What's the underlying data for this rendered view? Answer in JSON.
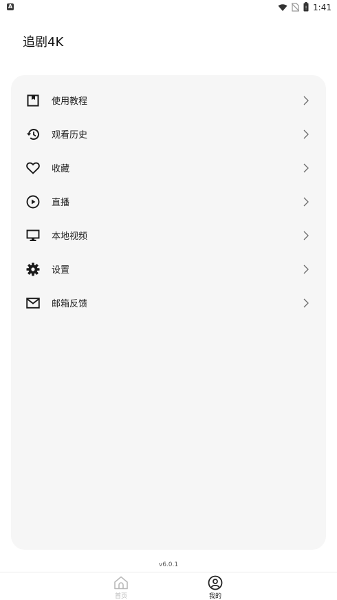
{
  "status_bar": {
    "notification_icon": "A",
    "time": "1:41",
    "icons": [
      "wifi-icon",
      "no-sim-icon",
      "battery-icon"
    ]
  },
  "header": {
    "title": "追剧4K"
  },
  "menu": {
    "items": [
      {
        "label": "使用教程",
        "icon": "bookmark-icon"
      },
      {
        "label": "观看历史",
        "icon": "history-icon"
      },
      {
        "label": "收藏",
        "icon": "heart-icon"
      },
      {
        "label": "直播",
        "icon": "play-circle-icon"
      },
      {
        "label": "本地视频",
        "icon": "monitor-icon"
      },
      {
        "label": "设置",
        "icon": "gear-icon"
      },
      {
        "label": "邮箱反馈",
        "icon": "mail-icon"
      }
    ]
  },
  "footer": {
    "version": "v6.0.1"
  },
  "bottom_nav": {
    "items": [
      {
        "label": "首页",
        "icon": "home-icon",
        "active": false
      },
      {
        "label": "我的",
        "icon": "profile-icon",
        "active": true
      }
    ]
  },
  "colors": {
    "card_background": "#f6f6f6",
    "text_primary": "#1b1b1b",
    "nav_inactive": "#b9b9b9",
    "nav_active": "#222222"
  }
}
